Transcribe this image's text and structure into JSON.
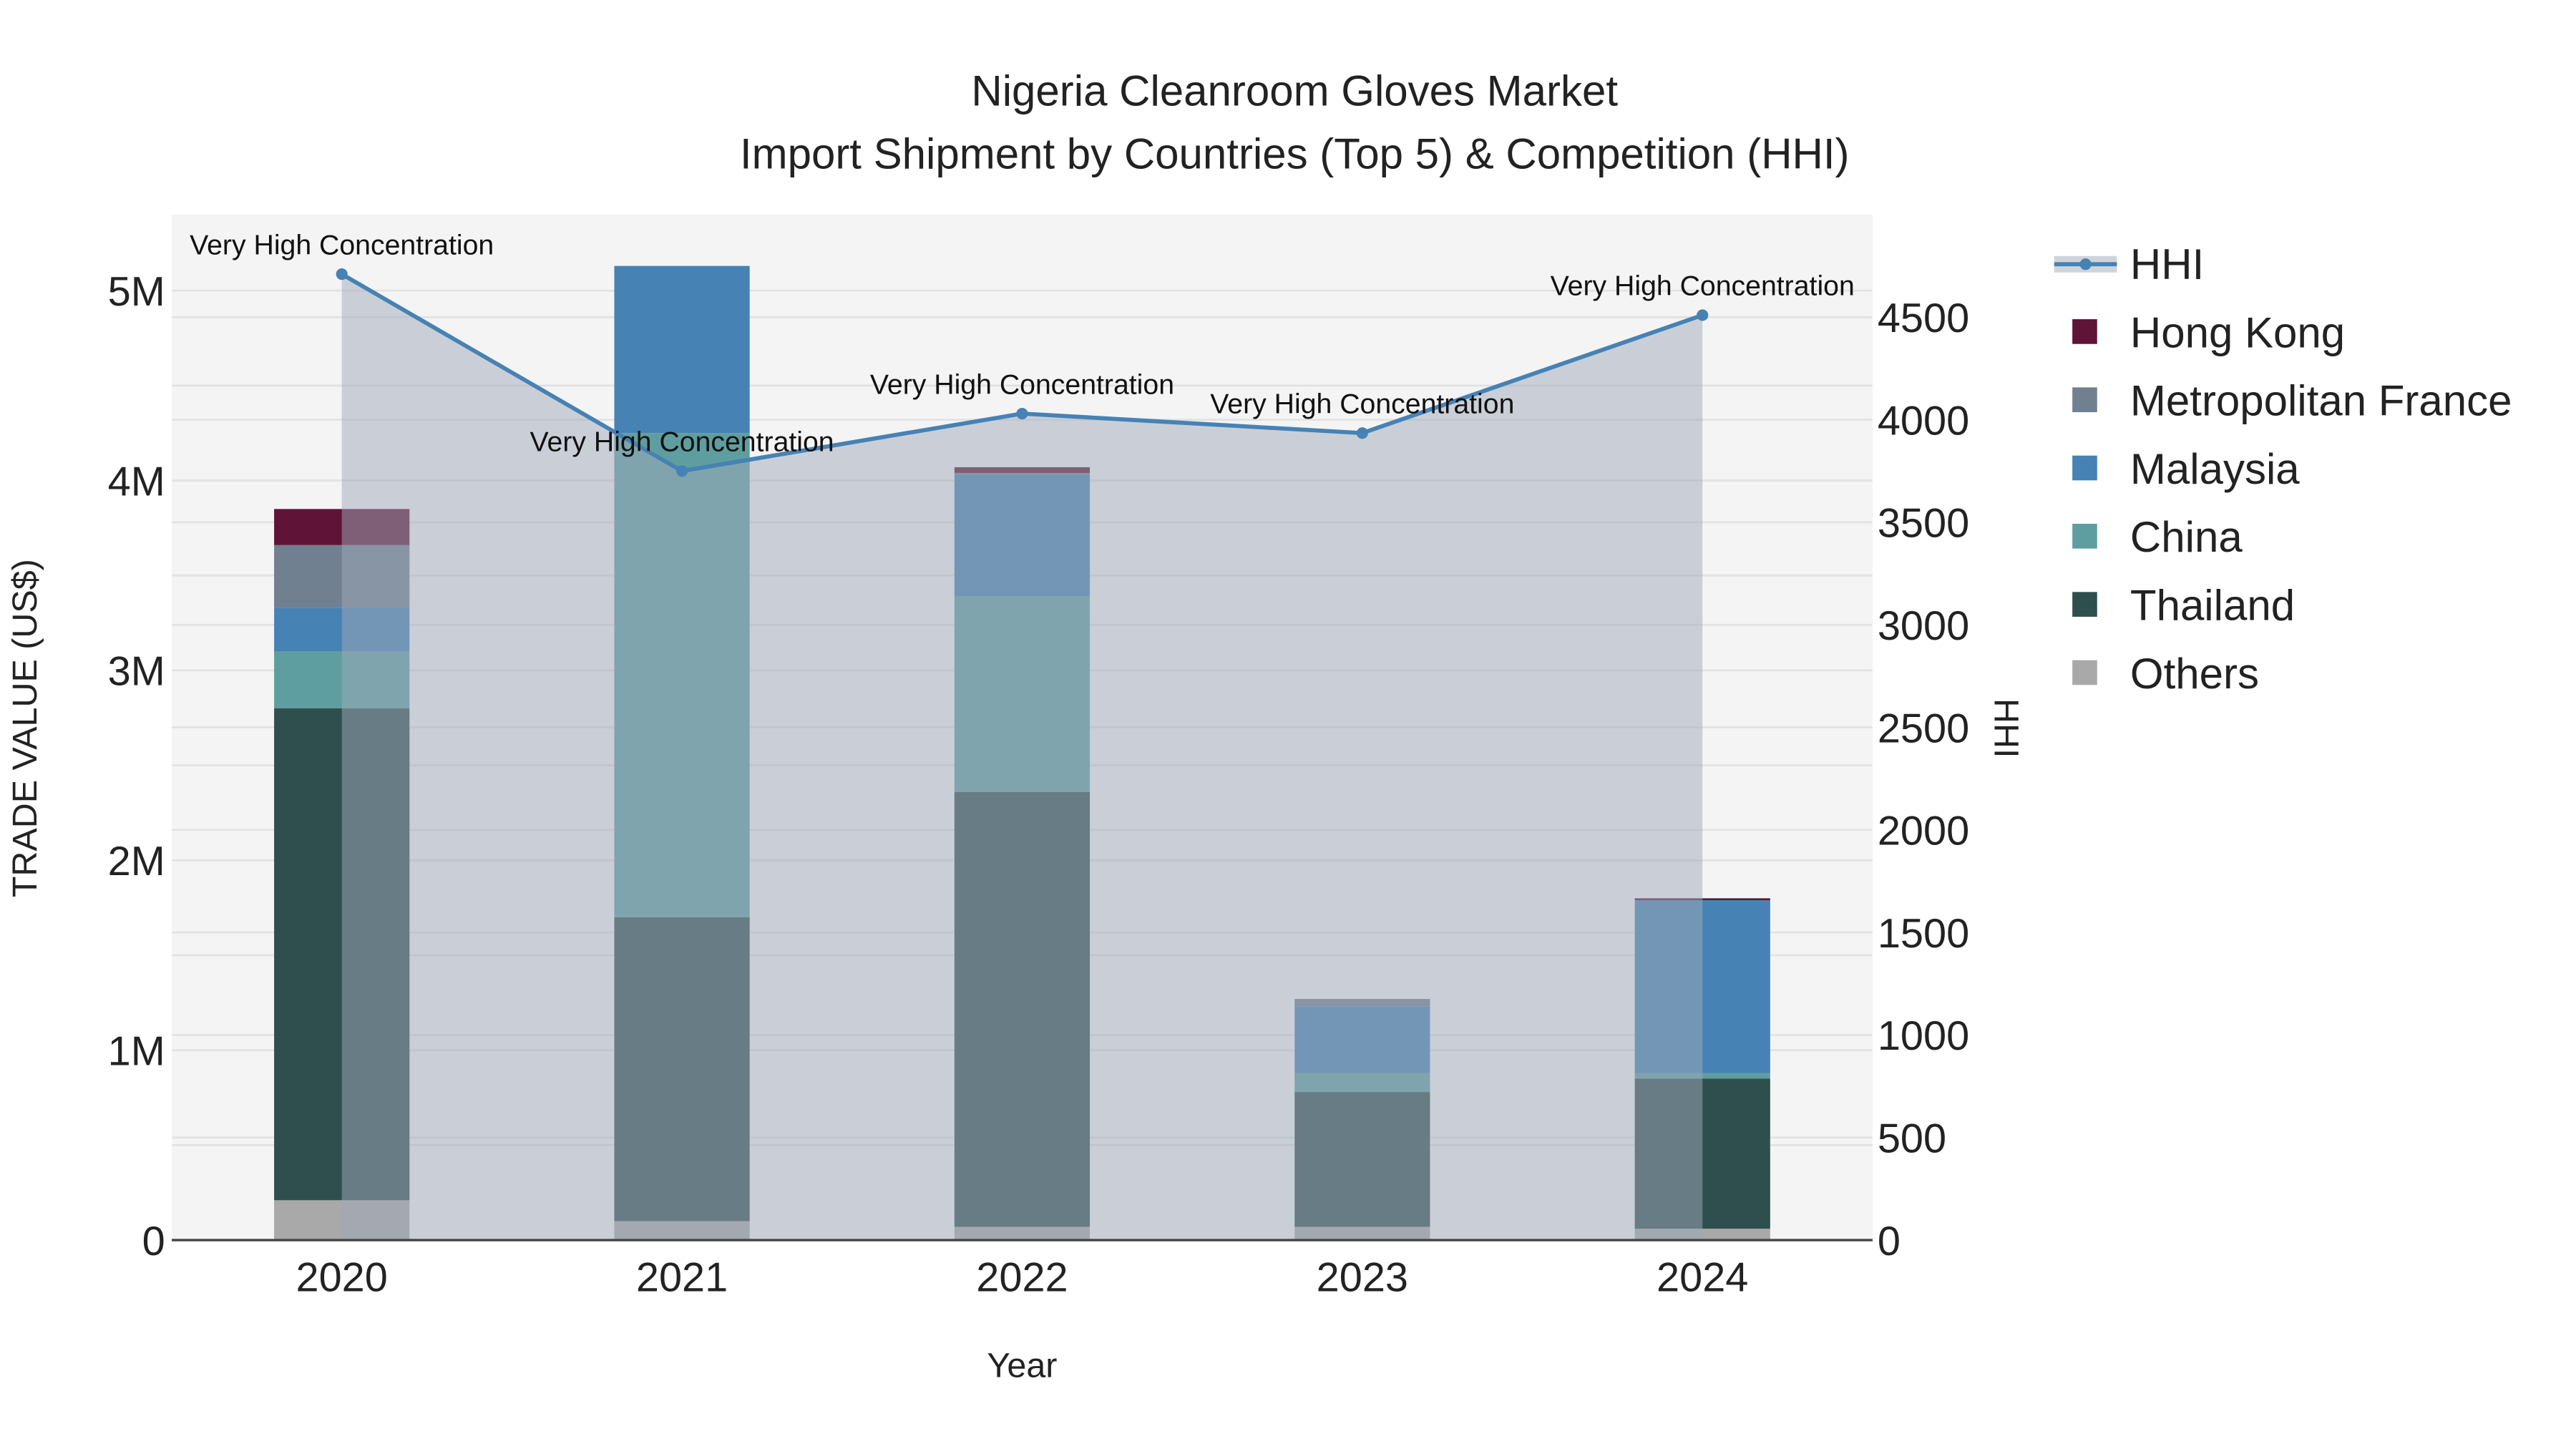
{
  "chart_data": {
    "type": "bar",
    "title": "Nigeria Cleanroom Gloves Market",
    "subtitle": "Import Shipment by Countries (Top 5) & Competition (HHI)",
    "xlabel": "Year",
    "ylabel": "TRADE VALUE (US$)",
    "y2label": "HHI",
    "categories": [
      "2020",
      "2021",
      "2022",
      "2023",
      "2024"
    ],
    "stacked": true,
    "ylim": [
      0,
      5400000
    ],
    "y2lim": [
      0,
      5000
    ],
    "yticks": [
      {
        "v": 0,
        "label": "0"
      },
      {
        "v": 1000000,
        "label": "1M"
      },
      {
        "v": 2000000,
        "label": "2M"
      },
      {
        "v": 3000000,
        "label": "3M"
      },
      {
        "v": 4000000,
        "label": "4M"
      },
      {
        "v": 5000000,
        "label": "5M"
      }
    ],
    "y2ticks": [
      0,
      500,
      1000,
      1500,
      2000,
      2500,
      3000,
      3500,
      4000,
      4500
    ],
    "grid": true,
    "legend_placement": "right",
    "series": [
      {
        "name": "Others",
        "color": "#a9a9a9",
        "values": [
          210000,
          100000,
          70000,
          70000,
          60000
        ]
      },
      {
        "name": "Thailand",
        "color": "#2f4f4f",
        "values": [
          2590000,
          1600000,
          2290000,
          710000,
          790000
        ]
      },
      {
        "name": "China",
        "color": "#5f9ea0",
        "values": [
          300000,
          2550000,
          1030000,
          100000,
          30000
        ]
      },
      {
        "name": "Malaysia",
        "color": "#4682b4",
        "values": [
          230000,
          880000,
          640000,
          350000,
          910000
        ]
      },
      {
        "name": "Metropolitan France",
        "color": "#708090",
        "values": [
          330000,
          0,
          10000,
          40000,
          0
        ]
      },
      {
        "name": "Hong Kong",
        "color": "#5f1336",
        "values": [
          190000,
          0,
          30000,
          0,
          10000
        ]
      }
    ],
    "line": {
      "name": "HHI",
      "color": "#4682b4",
      "axis": "right",
      "values": [
        4710,
        3750,
        4030,
        3935,
        4510
      ],
      "annotations": [
        "Very High Concentration",
        "Very High Concentration",
        "Very High Concentration",
        "Very High Concentration",
        "Very High Concentration"
      ]
    },
    "legend_order": [
      "HHI",
      "Hong Kong",
      "Metropolitan France",
      "Malaysia",
      "China",
      "Thailand",
      "Others"
    ]
  }
}
